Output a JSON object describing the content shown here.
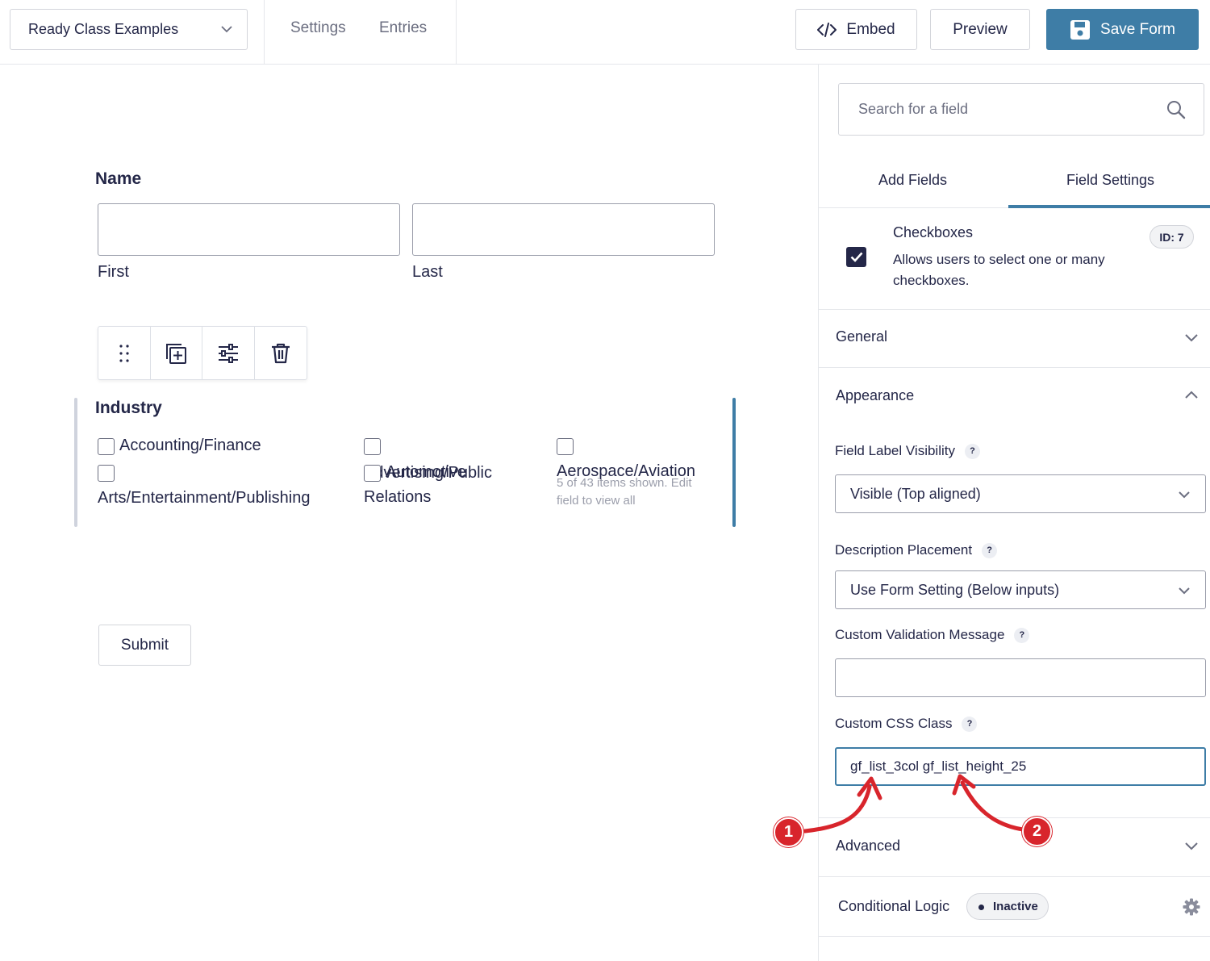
{
  "topbar": {
    "form_name": "Ready Class Examples",
    "links": [
      "Settings",
      "Entries"
    ],
    "embed_label": "Embed",
    "preview_label": "Preview",
    "save_label": "Save Form"
  },
  "form": {
    "name_field": {
      "label": "Name",
      "sublabels": [
        "First",
        "Last"
      ]
    },
    "toolbar_icons": [
      "drag-handle-icon",
      "duplicate-icon",
      "settings-sliders-icon",
      "trash-icon"
    ],
    "industry_field": {
      "label": "Industry",
      "choices": [
        "Accounting/Finance",
        "Advertising/Public Relations",
        "Aerospace/Aviation",
        "Arts/Entertainment/Publishing",
        "Automotive"
      ],
      "choices_note": "5 of 43 items shown. Edit field to view all"
    },
    "submit_label": "Submit"
  },
  "sidebar": {
    "search_placeholder": "Search for a field",
    "tabs": [
      "Add Fields",
      "Field Settings"
    ],
    "active_tab": "Field Settings",
    "field_info": {
      "title": "Checkboxes",
      "description": "Allows users to select one or many checkboxes.",
      "id_badge": "ID: 7"
    },
    "sections": {
      "general": "General",
      "appearance": "Appearance",
      "advanced": "Advanced",
      "conditional_logic": "Conditional Logic"
    },
    "appearance": {
      "label_visibility_label": "Field Label Visibility",
      "label_visibility_value": "Visible (Top aligned)",
      "description_placement_label": "Description Placement",
      "description_placement_value": "Use Form Setting (Below inputs)",
      "validation_message_label": "Custom Validation Message",
      "validation_message_value": "",
      "css_class_label": "Custom CSS Class",
      "css_class_value": "gf_list_3col gf_list_height_25"
    },
    "help_glyph": "?",
    "conditional_logic_status": "Inactive"
  },
  "annotations": [
    "1",
    "2"
  ],
  "colors": {
    "primary": "#3e7da6",
    "text": "#242748",
    "annotation": "#d8252c"
  }
}
